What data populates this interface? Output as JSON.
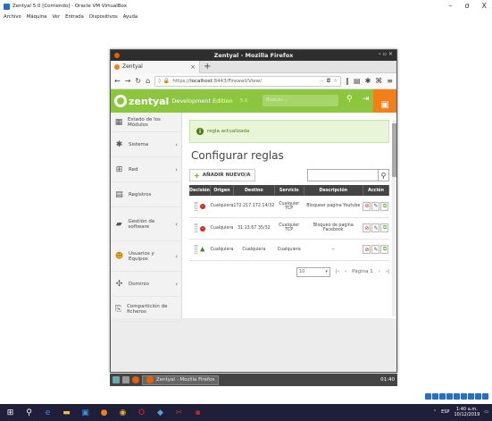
{
  "host": {
    "title": "Zentyal 5.0 [Corriendo] - Oracle VM VirtualBox",
    "controls": [
      "–",
      "σ",
      "X"
    ],
    "menu": [
      "Archivo",
      "Máquina",
      "Ver",
      "Entrada",
      "Dispositivos",
      "Ayuda"
    ]
  },
  "firefox": {
    "window_title": "Zentyal - Mozilla Firefox",
    "tab_label": "Zentyal",
    "url_prefix": "https://",
    "url_host": "localhost",
    "url_rest": ":8443/Firewall/View/",
    "url_more": "···"
  },
  "zentyal": {
    "brand": "zentyal",
    "edition": "Development Edition",
    "version": "5.0",
    "search_placeholder": "Buscar...",
    "sidebar": [
      {
        "label": "Estado de los Módulos",
        "icon": "modules-icon",
        "arrow": ""
      },
      {
        "label": "Sistema",
        "icon": "gear-icon",
        "arrow": "‹"
      },
      {
        "label": "Red",
        "icon": "network-icon",
        "arrow": "‹"
      },
      {
        "label": "Registros",
        "icon": "document-icon",
        "arrow": ""
      },
      {
        "label": "Gestión de software",
        "icon": "package-icon",
        "arrow": "‹"
      },
      {
        "label": "Usuarios y Equipos",
        "icon": "users-icon",
        "arrow": "‹"
      },
      {
        "label": "Dominio",
        "icon": "domain-icon",
        "arrow": "‹"
      },
      {
        "label": "Compartición de ficheros",
        "icon": "file-share-icon",
        "arrow": ""
      }
    ],
    "alert": "regla actualizada",
    "page_title": "Configurar reglas",
    "add_button": "AÑADIR NUEVO/A",
    "table": {
      "headers": [
        "Decisión",
        "Origen",
        "Destino",
        "Servicio",
        "Descripción",
        "Acción"
      ],
      "rows": [
        {
          "decision": "deny",
          "origin": "Cualquiera",
          "destination": "172.217.172.14/32",
          "service": "Cualquier TCP",
          "description": "Bloquear pagina Youtube"
        },
        {
          "decision": "deny",
          "origin": "Cualquiera",
          "destination": "31.13.67.35/32",
          "service": "Cualquier TCP",
          "description": "Bloqueo de pagina Facebook"
        },
        {
          "decision": "accept",
          "origin": "Cualquiera",
          "destination": "Cualquiera",
          "service": "Cualquiera",
          "description": "--"
        }
      ]
    },
    "pager": {
      "page_size": "10",
      "page_label": "Página 1"
    }
  },
  "guest_taskbar": {
    "task_label": "Zentyal - Mozilla Firefox",
    "clock": "01:40"
  },
  "win_tray": {
    "lang": "ESP",
    "time": "1:40 a.m.",
    "date": "10/12/2019"
  }
}
